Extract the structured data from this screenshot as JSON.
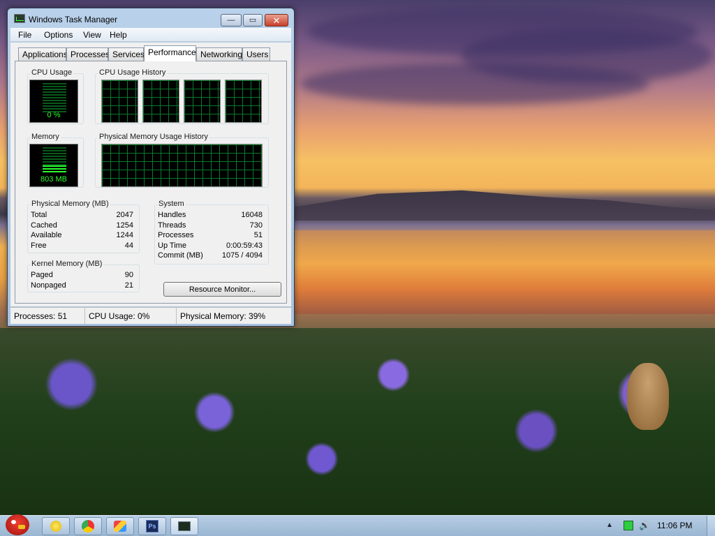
{
  "window": {
    "title": "Windows Task Manager",
    "controls": {
      "minimize": "—",
      "maximize": "▭",
      "close": "✕"
    }
  },
  "menu": [
    "File",
    "Options",
    "View",
    "Help"
  ],
  "tabs": [
    "Applications",
    "Processes",
    "Services",
    "Performance",
    "Networking",
    "Users"
  ],
  "active_tab": "Performance",
  "performance": {
    "cpu_usage": {
      "label": "CPU Usage",
      "value": "0 %"
    },
    "cpu_history": {
      "label": "CPU Usage History"
    },
    "memory": {
      "label": "Memory",
      "value": "803 MB"
    },
    "physical_memory_history": {
      "label": "Physical Memory Usage History"
    },
    "physical_memory": {
      "label": "Physical Memory (MB)",
      "rows": [
        {
          "key": "Total",
          "value": "2047"
        },
        {
          "key": "Cached",
          "value": "1254"
        },
        {
          "key": "Available",
          "value": "1244"
        },
        {
          "key": "Free",
          "value": "44"
        }
      ]
    },
    "kernel_memory": {
      "label": "Kernel Memory (MB)",
      "rows": [
        {
          "key": "Paged",
          "value": "90"
        },
        {
          "key": "Nonpaged",
          "value": "21"
        }
      ]
    },
    "system": {
      "label": "System",
      "rows": [
        {
          "key": "Handles",
          "value": "16048"
        },
        {
          "key": "Threads",
          "value": "730"
        },
        {
          "key": "Processes",
          "value": "51"
        },
        {
          "key": "Up Time",
          "value": "0:00:59:43"
        },
        {
          "key": "Commit (MB)",
          "value": "1075 / 4094"
        }
      ]
    },
    "resource_monitor_button": "Resource Monitor..."
  },
  "statusbar": {
    "processes": "Processes: 51",
    "cpu": "CPU Usage: 0%",
    "memory": "Physical Memory: 39%"
  },
  "taskbar": {
    "icons": [
      "angry-birds-start",
      "sticky-notes",
      "chrome",
      "paint",
      "photoshop",
      "task-manager"
    ],
    "clock": "11:06 PM"
  }
}
